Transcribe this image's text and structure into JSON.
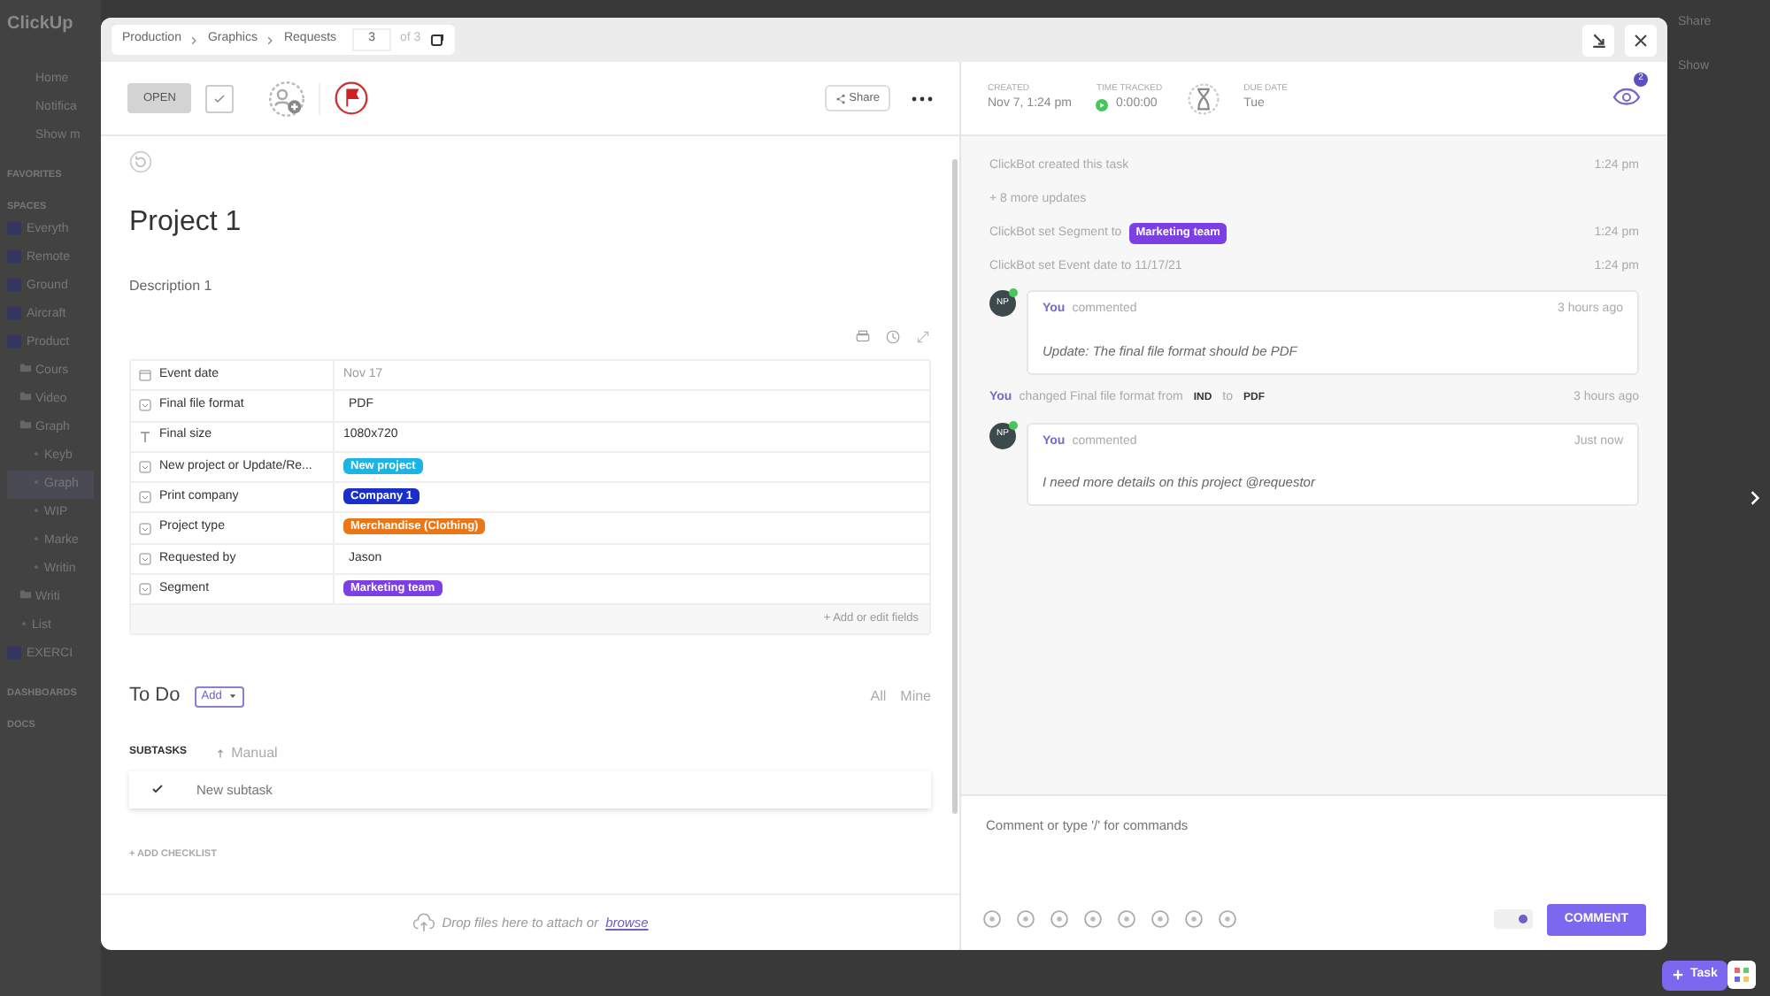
{
  "background": {
    "logo": "ClickUp",
    "nav": [
      "Home",
      "Notifica",
      "Show m"
    ],
    "sections": [
      {
        "title": "FAVORITES"
      },
      {
        "title": "SPACES",
        "items": [
          {
            "label": "Everyth",
            "kind": "space",
            "selected": false
          },
          {
            "label": "Remote",
            "kind": "space",
            "selected": false
          },
          {
            "label": "Ground",
            "kind": "space",
            "selected": false
          },
          {
            "label": "Aircraft",
            "kind": "space",
            "selected": false
          },
          {
            "label": "Product",
            "kind": "space",
            "selected": false,
            "children": [
              {
                "label": "Cours",
                "kind": "folder",
                "selected": false
              },
              {
                "label": "Video",
                "kind": "folder",
                "selected": false
              },
              {
                "label": "Graph",
                "kind": "folder",
                "selected": false,
                "children": [
                  {
                    "label": "Keyb",
                    "kind": "list",
                    "selected": false
                  },
                  {
                    "label": "Graph",
                    "kind": "list",
                    "selected": true
                  },
                  {
                    "label": "WIP",
                    "kind": "list",
                    "selected": false
                  },
                  {
                    "label": "Marke",
                    "kind": "list",
                    "selected": false
                  },
                  {
                    "label": "Writin",
                    "kind": "list",
                    "selected": false
                  }
                ]
              },
              {
                "label": "Writi",
                "kind": "folder",
                "selected": false
              },
              {
                "label": "List",
                "kind": "list",
                "selected": false
              }
            ]
          },
          {
            "label": "EXERCI",
            "kind": "space",
            "selected": false
          }
        ]
      },
      {
        "title": "DASHBOARDS"
      },
      {
        "title": "DOCS"
      }
    ],
    "header_actions": [
      "Share",
      "Show"
    ],
    "new_task": "Task"
  },
  "modal": {
    "breadcrumb": [
      "Production",
      "Graphics",
      "Requests"
    ],
    "counter": {
      "value": "3",
      "total": "of 3"
    },
    "status": "OPEN",
    "share": "Share",
    "meta": [
      {
        "label": "CREATED",
        "value": "Nov 7, 1:24 pm",
        "kind": "text"
      },
      {
        "label": "TIME TRACKED",
        "value": "0:00:00",
        "kind": "timer"
      },
      {
        "label": "DUE DATE",
        "value": "Tue",
        "kind": "text"
      }
    ],
    "watchers": "2",
    "title": "Project 1",
    "description": "Description 1",
    "fields": [
      {
        "kind": "date",
        "label": "Event date",
        "value": "Nov 17"
      },
      {
        "kind": "dropdown",
        "label": "Final file format",
        "value": "PDF"
      },
      {
        "kind": "text",
        "label": "Final size",
        "value": "1080x720"
      },
      {
        "kind": "dropdown",
        "label": "New project or Update/Re...",
        "value": "New project",
        "color": "#1bb4e4"
      },
      {
        "kind": "dropdown",
        "label": "Print company",
        "value": "Company 1",
        "color": "#1a2fc9"
      },
      {
        "kind": "dropdown",
        "label": "Project type",
        "value": "Merchandise (Clothing)",
        "color": "#ec7615"
      },
      {
        "kind": "dropdown",
        "label": "Requested by",
        "value": "Jason"
      },
      {
        "kind": "dropdown",
        "label": "Segment",
        "value": "Marketing team",
        "color": "#7c3fe4"
      }
    ],
    "add_fields": "+ Add or edit fields",
    "todo": {
      "title": "To Do",
      "add": "Add",
      "filters": [
        "All",
        "Mine"
      ]
    },
    "subtasks": {
      "title": "SUBTASKS",
      "sort": "Manual",
      "placeholder": "New subtask"
    },
    "add_checklist": "+ ADD CHECKLIST",
    "drop": {
      "text": "Drop files here to attach or",
      "link": "browse"
    },
    "activity": [
      {
        "kind": "event",
        "text": "ClickBot created this task",
        "time": "1:24 pm"
      },
      {
        "kind": "more",
        "text": "+ 8 more updates"
      },
      {
        "kind": "tag_event",
        "text": "ClickBot set Segment to",
        "tag": "Marketing team",
        "color": "#7c3fe4",
        "time": "1:24 pm"
      },
      {
        "kind": "event",
        "text": "ClickBot set Event date to 11/17/21",
        "time": "1:24 pm"
      },
      {
        "kind": "comment",
        "initials": "NP",
        "author": "You",
        "action": "commented",
        "time": "3 hours ago",
        "body": "Update: The final file format should be PDF"
      },
      {
        "kind": "change",
        "author": "You",
        "text": "changed Final file format from",
        "from": "IND",
        "joiner": "to",
        "to": "PDF",
        "time": "3 hours ago"
      },
      {
        "kind": "comment",
        "initials": "NP",
        "author": "You",
        "action": "commented",
        "time": "Just now",
        "body": "I need more details on this project @requestor"
      }
    ],
    "composer": {
      "placeholder": "Comment or type '/' for commands",
      "toggle_on": true,
      "button": "COMMENT"
    }
  }
}
